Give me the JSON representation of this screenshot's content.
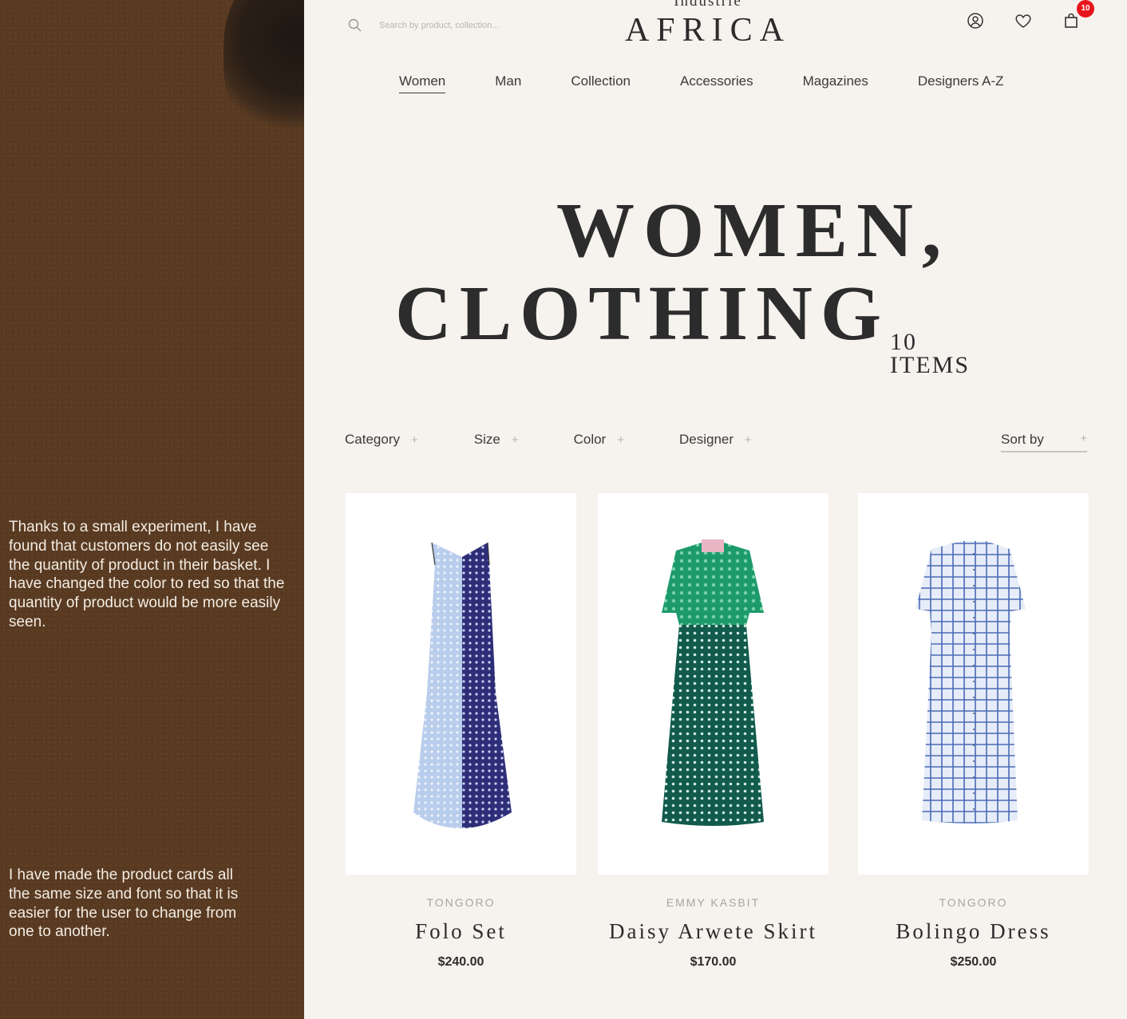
{
  "annotations": [
    "Thanks to a small experiment, I have found that customers do not easily see the quantity of product in their basket. I have changed the color to red so that the quantity of product would be more easily seen.",
    "I have made the product cards all the same size and font so that it is easier for the user to change from one to another."
  ],
  "header": {
    "search_placeholder": "Search by product, collection...",
    "brand_top": "Industrie",
    "brand": "AFRICA",
    "cart_count": "10",
    "badge_color": "#e8161c"
  },
  "nav": [
    "Women",
    "Man",
    "Collection",
    "Accessories",
    "Magazines",
    "Designers A-Z"
  ],
  "hero": {
    "line1": "WOMEN,",
    "line2": "CLOTHING",
    "count_number": "10",
    "count_label": "ITEMS"
  },
  "filters": [
    "Category",
    "Size",
    "Color",
    "Designer"
  ],
  "sort_label": "Sort by",
  "products": [
    {
      "designer": "TONGORO",
      "name": "Folo Set",
      "price": "$240.00"
    },
    {
      "designer": "EMMY KASBIT",
      "name": "Daisy Arwete Skirt",
      "price": "$170.00"
    },
    {
      "designer": "TONGORO",
      "name": "Bolingo Dress",
      "price": "$250.00"
    }
  ]
}
